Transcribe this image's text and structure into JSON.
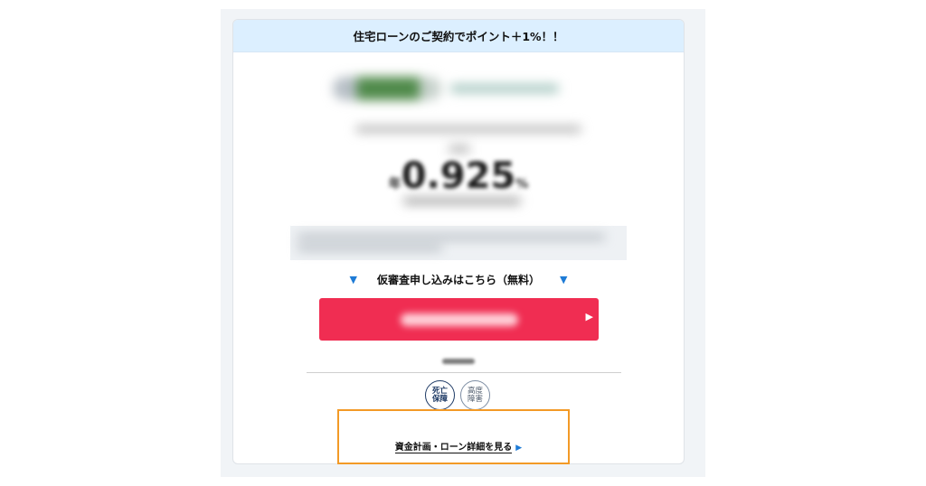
{
  "banner": {
    "title": "住宅ローンのご契約でポイント＋1%！！"
  },
  "rate": {
    "value": "0.925",
    "prefix": "年",
    "suffix": "%"
  },
  "apply": {
    "heading": "仮審査申し込みはこちら（無料）",
    "button_arrow": "▶"
  },
  "badges": [
    {
      "lines": [
        "死亡",
        "保障"
      ]
    },
    {
      "lines": [
        "高度",
        "障害"
      ]
    }
  ],
  "details": {
    "link_label": "資金計画・ローン詳細を見る",
    "arrow": "▶"
  },
  "colors": {
    "banner_bg": "#dcefff",
    "apply_button": "#f02d52",
    "highlight": "#f39a26",
    "accent_blue": "#1e7bd6"
  }
}
